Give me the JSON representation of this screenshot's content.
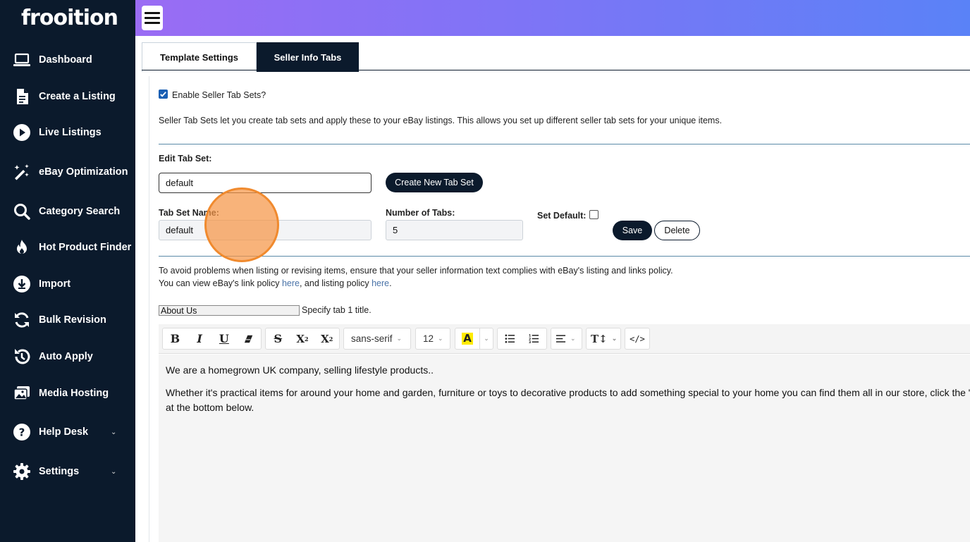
{
  "app": {
    "logo": "frooition"
  },
  "sidebar": {
    "items": [
      {
        "label": "Dashboard",
        "icon": "laptop-icon"
      },
      {
        "label": "Create a Listing",
        "icon": "document-icon"
      },
      {
        "label": "Live Listings",
        "icon": "play-circle-icon"
      },
      {
        "label": "eBay Optimization",
        "icon": "magic-wand-icon"
      },
      {
        "label": "Category Search",
        "icon": "search-icon"
      },
      {
        "label": "Hot Product Finder",
        "icon": "flame-icon"
      },
      {
        "label": "Import",
        "icon": "download-circle-icon"
      },
      {
        "label": "Bulk Revision",
        "icon": "refresh-icon"
      },
      {
        "label": "Auto Apply",
        "icon": "history-icon"
      },
      {
        "label": "Media Hosting",
        "icon": "images-icon"
      },
      {
        "label": "Help Desk",
        "icon": "help-circle-icon",
        "has_submenu": true
      },
      {
        "label": "Settings",
        "icon": "gear-icon",
        "has_submenu": true
      }
    ]
  },
  "tabs": [
    {
      "label": "Template Settings",
      "active": false
    },
    {
      "label": "Seller Info Tabs",
      "active": true
    }
  ],
  "seller_tabs": {
    "enable_label": "Enable Seller Tab Sets?",
    "enable_checked": true,
    "description": "Seller Tab Sets let you create tab sets and apply these to your eBay listings. This allows you set up different seller tab sets for your unique items.",
    "edit_label": "Edit Tab Set:",
    "edit_value": "default",
    "create_button": "Create New Tab Set",
    "name_label": "Tab Set Name:",
    "name_value": "default",
    "count_label": "Number of Tabs:",
    "count_value": "5",
    "default_label": "Set Default:",
    "default_checked": false,
    "save_button": "Save",
    "delete_button": "Delete",
    "policy_line1": "To avoid problems when listing or revising items, ensure that your seller information text complies with eBay's listing and links policy.",
    "policy_line2_a": "You can view eBay's link policy ",
    "policy_link1": "here",
    "policy_line2_b": ", and listing policy ",
    "policy_link2": "here",
    "policy_line2_c": ".",
    "tab_title_value": "About Us",
    "tab_title_hint": "Specify tab 1 title."
  },
  "editor": {
    "font_family": "sans-serif",
    "font_size": "12",
    "paragraph1": "We are a homegrown UK company, selling lifestyle products..",
    "paragraph2_line1": "Whether it's practical items for around your home and garden, furniture or toys to decorative products to add something special to your home you can find them all in our store, click the \"",
    "paragraph2_line2": "at the bottom below."
  },
  "colors": {
    "sidebar_bg": "#0b1a2c",
    "topbar_start": "#9a6cf4",
    "topbar_end": "#5a82f7",
    "accent_dark": "#0b1a2c",
    "link": "#4a73a8",
    "click_marker": "#f08a2e"
  }
}
